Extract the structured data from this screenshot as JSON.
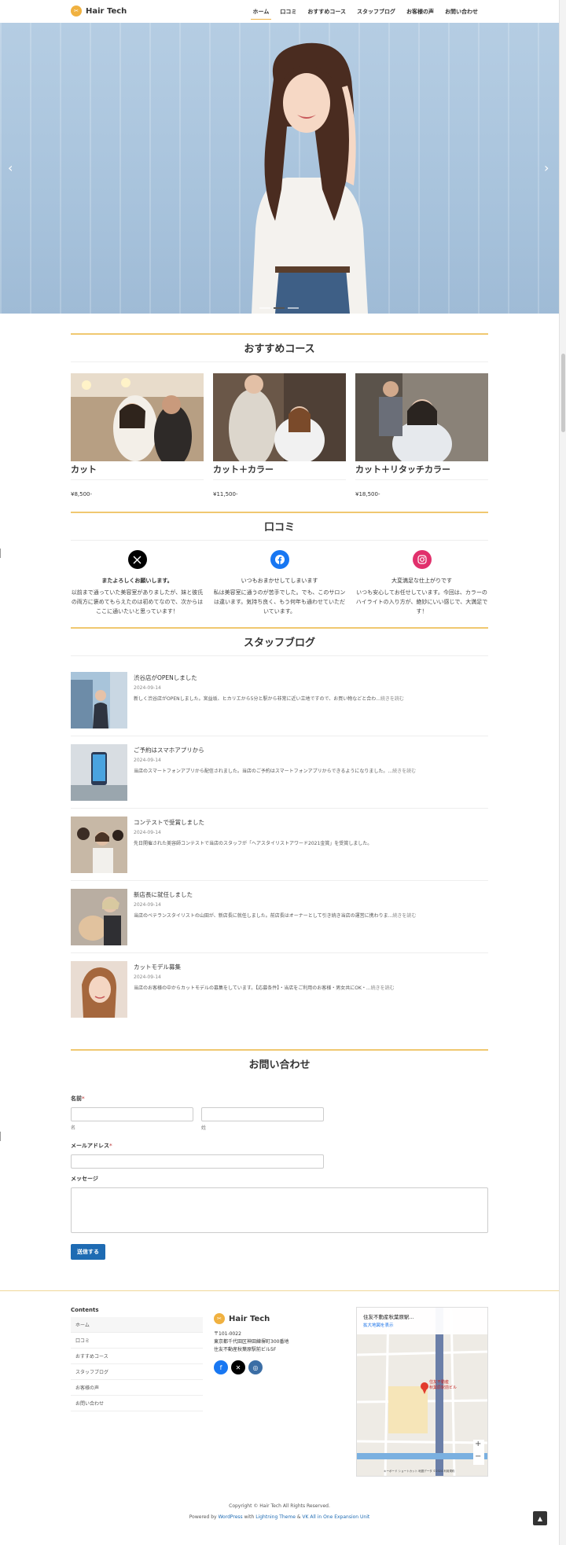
{
  "header": {
    "logo_text": "Hair Tech",
    "nav": [
      {
        "label": "ホーム",
        "active": true
      },
      {
        "label": "口コミ"
      },
      {
        "label": "おすすめコース"
      },
      {
        "label": "スタッフブログ"
      },
      {
        "label": "お客様の声"
      },
      {
        "label": "お問い合わせ"
      }
    ]
  },
  "hero": {
    "prev_icon": "chevron-left-icon",
    "next_icon": "chevron-right-icon"
  },
  "courses": {
    "title": "おすすめコース",
    "items": [
      {
        "name": "カット",
        "price": "¥8,500-"
      },
      {
        "name": "カット＋カラー",
        "price": "¥11,500-"
      },
      {
        "name": "カット＋リタッチカラー",
        "price": "¥18,500-"
      }
    ]
  },
  "reviews": {
    "title": "口コミ",
    "items": [
      {
        "icon": "x-icon",
        "head": "またよろしくお願いします。",
        "body": "以前まで通っていた美容室がありましたが、妹と彼氏の両方に褒めてもらえたのは初めてなので、次からはここに通いたいと思っています！",
        "color": "#000000"
      },
      {
        "icon": "facebook-icon",
        "head": "いつもおまかせしてしまいます",
        "body": "私は美容室に通うのが苦手でした。でも、このサロンは違います。気持ち良く、もう何年も通わせていただいています。",
        "color": "#1877f2"
      },
      {
        "icon": "instagram-icon",
        "head": "大変満足な仕上がりです",
        "body": "いつも安心してお任せしています。今回は、カラーのハイライトの入り方が、絶妙にいい感じで、大満足です！",
        "color": "#e1306c"
      }
    ]
  },
  "blog": {
    "title": "スタッフブログ",
    "more_label": "続きを読む",
    "posts": [
      {
        "title": "渋谷店がOPENしました",
        "date": "2024-09-14",
        "excerpt": "新しく渋谷店がOPENしました。宮益坂、ヒカリエから5分と駅から非常に近い立地ですので、お買い物などと合わ..."
      },
      {
        "title": "ご予約はスマホアプリから",
        "date": "2024-09-14",
        "excerpt": "当店のスマートフォンアプリから配信されました。当店のご予約はスマートフォンアプリからできるようになりました。..."
      },
      {
        "title": "コンテストで受賞しました",
        "date": "2024-09-14",
        "excerpt": "先日開催された美容師コンテストで当店のスタッフが「ヘアスタイリストアワード2021金賞」を受賞しました。"
      },
      {
        "title": "新店長に就任しました",
        "date": "2024-09-14",
        "excerpt": "当店のベテランスタイリストの山田が、新店長に就任しました。前店長はオーナーとして引き続き当店の運営に携わりま..."
      },
      {
        "title": "カットモデル募集",
        "date": "2024-09-14",
        "excerpt": "当店のお客様の中からカットモデルの募集をしています。【応募条件】・当店をご利用のお客様・男女共にOK・..."
      }
    ]
  },
  "contact": {
    "title": "お問い合わせ",
    "name_label": "名前",
    "required_mark": "*",
    "first_label": "名",
    "last_label": "姓",
    "email_label": "メールアドレス",
    "message_label": "メッセージ",
    "submit_label": "送信する"
  },
  "footer": {
    "menu_title": "Contents",
    "menu": [
      "ホーム",
      "口コミ",
      "おすすめコース",
      "スタッフブログ",
      "お客様の声",
      "お問い合わせ"
    ],
    "logo_text": "Hair Tech",
    "address": [
      "〒101-0022",
      "東京都千代田区神田練塀町300番地",
      "住友不動産秋葉原駅前ビル5F"
    ],
    "social": [
      {
        "icon": "facebook-icon",
        "color": "#1877f2"
      },
      {
        "icon": "x-icon",
        "color": "#000000"
      },
      {
        "icon": "instagram-icon",
        "color": "#3b6ea5"
      }
    ],
    "map": {
      "place": "住友不動産秋葉原駅...",
      "link": "拡大地図を表示",
      "pin_label": "住友不動産\n秋葉原駅前ビル",
      "attrib": "キーボード ショートカット  地図データ ©2024  利用規約"
    },
    "copyright": "Copyright © Hair Tech All Rights Reserved.",
    "powered": {
      "prefix": "Powered by ",
      "wp": "WordPress",
      "mid": " with ",
      "theme": "Lightning Theme",
      "amp": " & ",
      "unit": "VK All in One Expansion Unit"
    }
  }
}
